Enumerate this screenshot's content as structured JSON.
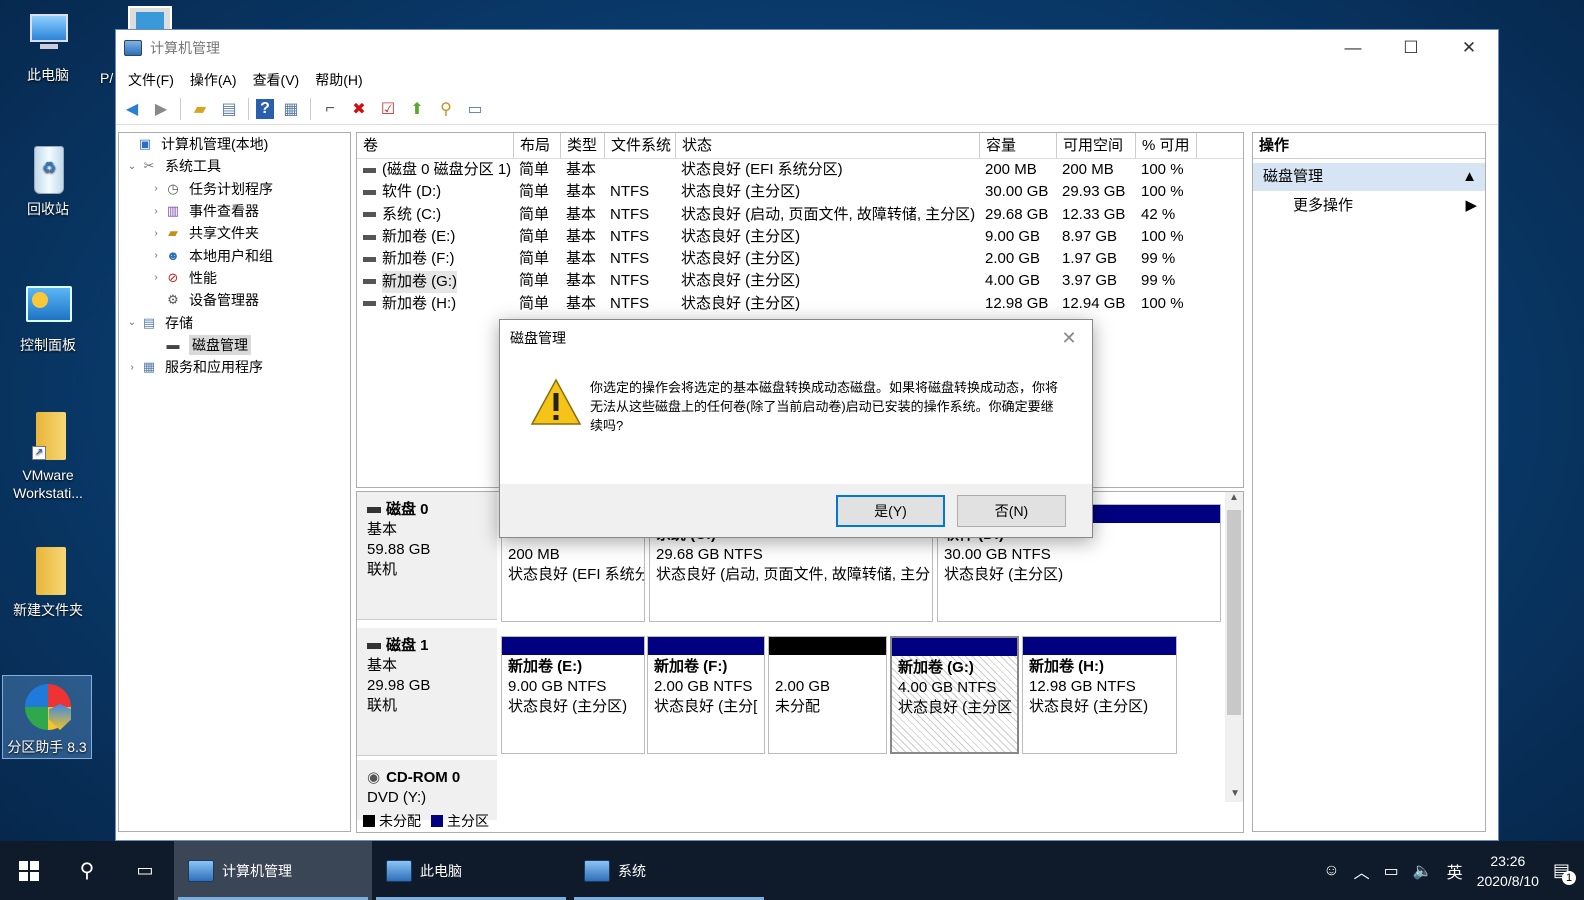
{
  "desktop": {
    "icons": [
      "此电脑",
      "回收站",
      "控制面板",
      "VMware Workstati...",
      "新建文件夹",
      "分区助手 8.3"
    ],
    "partial_label": "P/"
  },
  "window": {
    "title": "计算机管理",
    "minimize": "—",
    "maximize": "☐",
    "close": "✕"
  },
  "menu": [
    "文件(F)",
    "操作(A)",
    "查看(V)",
    "帮助(H)"
  ],
  "tree": [
    {
      "label": "计算机管理(本地)",
      "level": 0,
      "exp": ""
    },
    {
      "label": "系统工具",
      "level": 1,
      "exp": "⌄"
    },
    {
      "label": "任务计划程序",
      "level": 2,
      "exp": "›"
    },
    {
      "label": "事件查看器",
      "level": 2,
      "exp": "›"
    },
    {
      "label": "共享文件夹",
      "level": 2,
      "exp": "›"
    },
    {
      "label": "本地用户和组",
      "level": 2,
      "exp": "›"
    },
    {
      "label": "性能",
      "level": 2,
      "exp": "›"
    },
    {
      "label": "设备管理器",
      "level": 2,
      "exp": ""
    },
    {
      "label": "存储",
      "level": 1,
      "exp": "⌄"
    },
    {
      "label": "磁盘管理",
      "level": 2,
      "exp": "",
      "selected": true
    },
    {
      "label": "服务和应用程序",
      "level": 1,
      "exp": "›"
    }
  ],
  "volumes": {
    "headers": [
      "卷",
      "布局",
      "类型",
      "文件系统",
      "状态",
      "容量",
      "可用空间",
      "% 可用"
    ],
    "rows": [
      [
        "(磁盘 0 磁盘分区 1)",
        "简单",
        "基本",
        "",
        "状态良好 (EFI 系统分区)",
        "200 MB",
        "200 MB",
        "100 %"
      ],
      [
        "软件 (D:)",
        "简单",
        "基本",
        "NTFS",
        "状态良好 (主分区)",
        "30.00 GB",
        "29.93 GB",
        "100 %"
      ],
      [
        "系统 (C:)",
        "简单",
        "基本",
        "NTFS",
        "状态良好 (启动, 页面文件, 故障转储, 主分区)",
        "29.68 GB",
        "12.33 GB",
        "42 %"
      ],
      [
        "新加卷 (E:)",
        "简单",
        "基本",
        "NTFS",
        "状态良好 (主分区)",
        "9.00 GB",
        "8.97 GB",
        "100 %"
      ],
      [
        "新加卷 (F:)",
        "简单",
        "基本",
        "NTFS",
        "状态良好 (主分区)",
        "2.00 GB",
        "1.97 GB",
        "99 %"
      ],
      [
        "新加卷 (G:)",
        "简单",
        "基本",
        "NTFS",
        "状态良好 (主分区)",
        "4.00 GB",
        "3.97 GB",
        "99 %"
      ],
      [
        "新加卷 (H:)",
        "简单",
        "基本",
        "NTFS",
        "状态良好 (主分区)",
        "12.98 GB",
        "12.94 GB",
        "100 %"
      ]
    ]
  },
  "disks": {
    "disk0": {
      "name": "磁盘 0",
      "type": "基本",
      "size": "59.88 GB",
      "status": "联机",
      "parts": [
        {
          "title": "",
          "line1": "200 MB",
          "line2": "状态良好 (EFI 系统分"
        },
        {
          "title": "系统 (C:)",
          "line1": "29.68 GB NTFS",
          "line2": "状态良好 (启动, 页面文件, 故障转储, 主分"
        },
        {
          "title": "软件 (D:)",
          "line1": "30.00 GB NTFS",
          "line2": "状态良好 (主分区)"
        }
      ]
    },
    "disk1": {
      "name": "磁盘 1",
      "type": "基本",
      "size": "29.98 GB",
      "status": "联机",
      "parts": [
        {
          "title": "新加卷 (E:)",
          "line1": "9.00 GB NTFS",
          "line2": "状态良好 (主分区)"
        },
        {
          "title": "新加卷 (F:)",
          "line1": "2.00 GB NTFS",
          "line2": "状态良好 (主分["
        },
        {
          "title": "",
          "line1": "2.00 GB",
          "line2": "未分配"
        },
        {
          "title": "新加卷 (G:)",
          "line1": "4.00 GB NTFS",
          "line2": "状态良好 (主分区"
        },
        {
          "title": "新加卷 (H:)",
          "line1": "12.98 GB NTFS",
          "line2": "状态良好 (主分区)"
        }
      ]
    },
    "cdrom": {
      "name": "CD-ROM 0",
      "type": "DVD (Y:)"
    }
  },
  "legend": {
    "unallocated": "未分配",
    "primary": "主分区"
  },
  "actions": {
    "header": "操作",
    "section": "磁盘管理",
    "item": "更多操作"
  },
  "dialog": {
    "title": "磁盘管理",
    "message": "你选定的操作会将选定的基本磁盘转换成动态磁盘。如果将磁盘转换成动态，你将无法从这些磁盘上的任何卷(除了当前启动卷)启动已安装的操作系统。你确定要继续吗?",
    "yes": "是(Y)",
    "no": "否(N)"
  },
  "taskbar": {
    "tasks": [
      "计算机管理",
      "此电脑",
      "系统"
    ],
    "ime": "英",
    "time": "23:26",
    "date": "2020/8/10",
    "notif": "1"
  },
  "colors": {
    "primary_partition": "#000080",
    "unallocated": "#000000",
    "selection": "#d6e4f4"
  }
}
